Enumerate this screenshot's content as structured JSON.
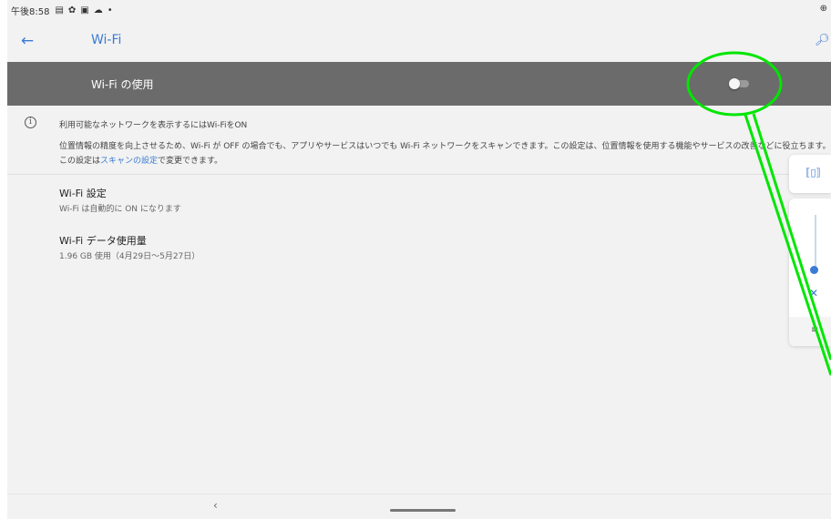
{
  "status_bar": {
    "time": "午後8:58",
    "icons": [
      "message-icon",
      "gear-icon",
      "image-icon",
      "cloud-icon",
      "dot-icon"
    ],
    "right_icon": "vpn-key-icon"
  },
  "app_bar": {
    "title": "Wi-Fi",
    "back_icon": "arrow-left-icon",
    "search_icon": "search-icon"
  },
  "master_switch": {
    "label": "Wi-Fi の使用",
    "state": "off"
  },
  "info": {
    "main": "利用可能なネットワークを表示するにはWi-FiをON",
    "desc_before": "位置情報の精度を向上させるため、Wi-Fi が OFF の場合でも、アプリやサービスはいつでも Wi-Fi ネットワークをスキャンできます。この設定は、位置情報を使用する機能やサービスの改善などに役立ちます。この設定は",
    "desc_link": "スキャンの設定",
    "desc_after": "で変更できます。"
  },
  "items": [
    {
      "title": "Wi-Fi 設定",
      "subtitle": "Wi-Fi は自動的に ON になります"
    },
    {
      "title": "Wi-Fi データ使用量",
      "subtitle": "1.96 GB 使用（4月29日〜5月27日）"
    }
  ],
  "volume_panel": {
    "mode_icon": "vibrate-icon",
    "mute_icon": "music-off-icon",
    "footer_icon": "settings-sliders-icon"
  },
  "nav_bar": {
    "back_label": "‹"
  },
  "colors": {
    "accent": "#3a7bd5",
    "master_bar": "#6b6b6b",
    "background": "#f2f2f2",
    "annotation": "#00e600"
  }
}
